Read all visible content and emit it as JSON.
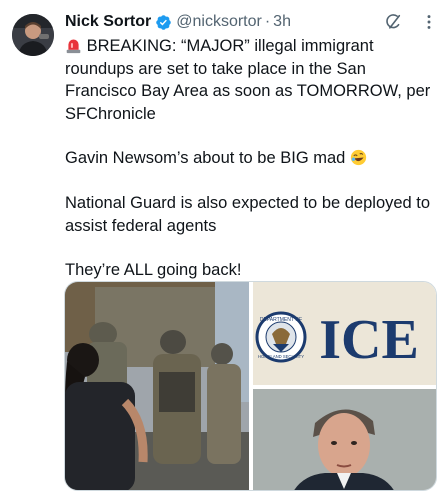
{
  "tweet": {
    "author_name": "Nick Sortor",
    "handle": "@nicksortor",
    "separator": "·",
    "time": "3h",
    "lines": {
      "p1": "BREAKING: “MAJOR” illegal immigrant roundups are set to take place in the San Francisco Bay Area as soon as TOMORROW, per SFChronicle",
      "p2": "Gavin Newsom’s about to be BIG mad",
      "p3": "National Guard is also expected to be deployed to assist federal agents",
      "p4": "They’re ALL going back!"
    },
    "ice_sign_text": "ICE",
    "seal_top_text": "DEPARTMENT OF",
    "seal_bottom_text": "HOMELAND SECURITY"
  },
  "icons": {
    "verified": "verified-badge-icon",
    "grok": "grok-icon",
    "more": "more-icon",
    "siren": "siren-emoji-icon",
    "laugh": "rofl-emoji-icon"
  },
  "colors": {
    "verified_blue": "#1d9bf0",
    "secondary_text": "#536471",
    "text": "#0f1419",
    "ice_blue": "#1c3b6e"
  }
}
